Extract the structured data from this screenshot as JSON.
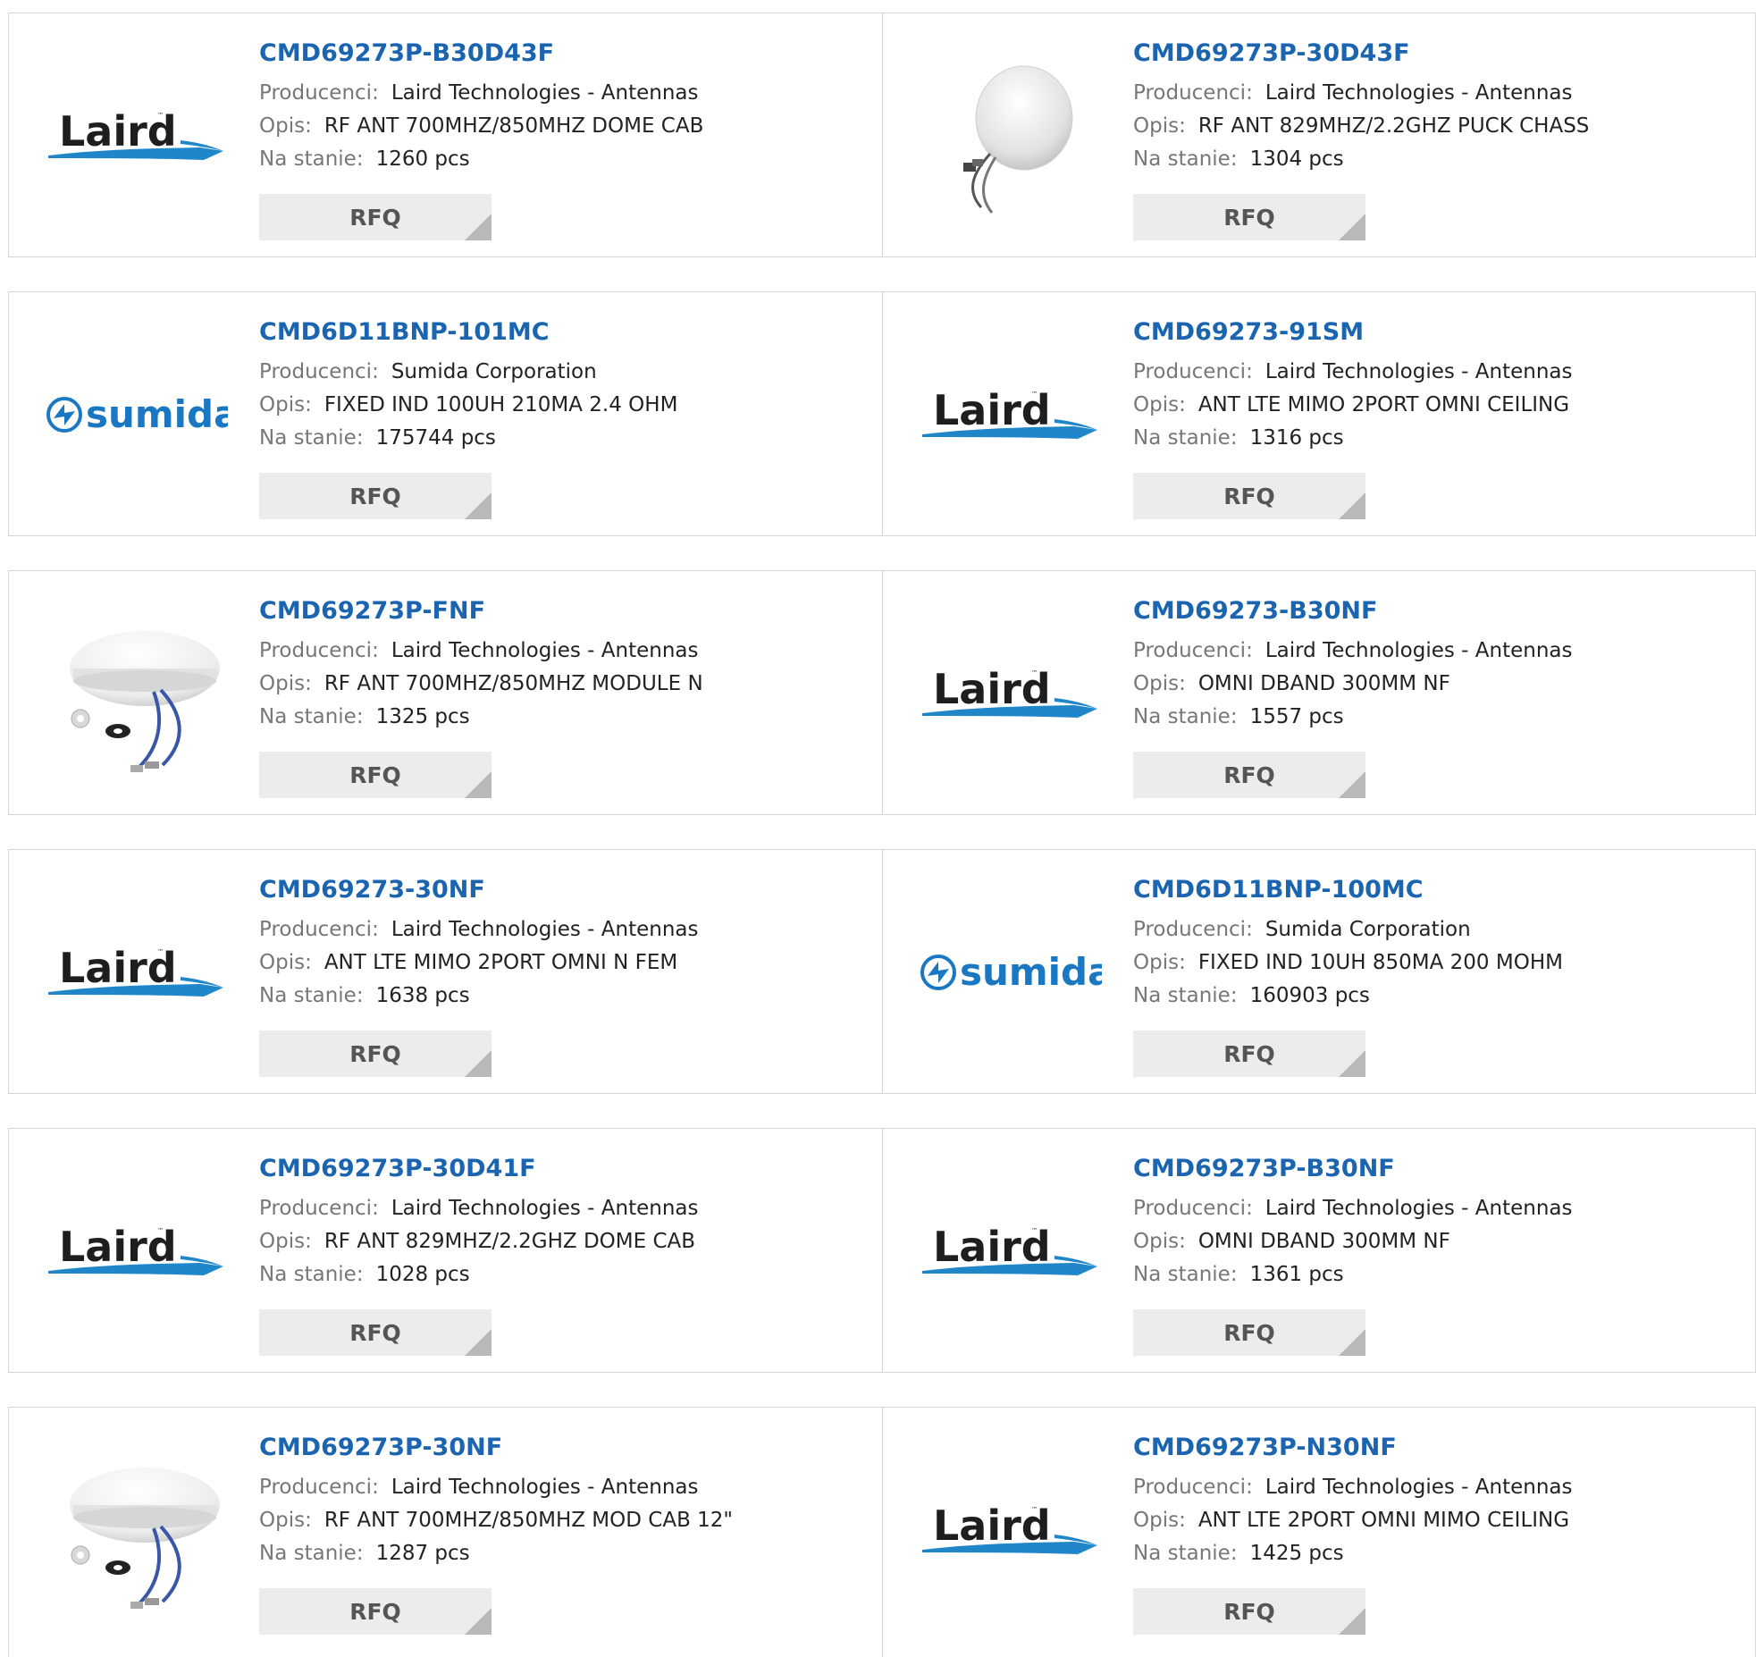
{
  "labels": {
    "manufacturer": "Producenci:",
    "description": "Opis:",
    "stock": "Na stanie:",
    "rfq": "RFQ"
  },
  "products": [
    {
      "part": "CMD69273P-B30D43F",
      "manufacturer": "Laird Technologies - Antennas",
      "description": "RF ANT 700MHZ/850MHZ DOME CAB",
      "stock": "1260 pcs",
      "image": "laird-logo"
    },
    {
      "part": "CMD69273P-30D43F",
      "manufacturer": "Laird Technologies - Antennas",
      "description": "RF ANT 829MHZ/2.2GHZ PUCK CHASS",
      "stock": "1304 pcs",
      "image": "puck-antenna-photo"
    },
    {
      "part": "CMD6D11BNP-101MC",
      "manufacturer": "Sumida Corporation",
      "description": "FIXED IND 100UH 210MA 2.4 OHM",
      "stock": "175744 pcs",
      "image": "sumida-logo"
    },
    {
      "part": "CMD69273-91SM",
      "manufacturer": "Laird Technologies - Antennas",
      "description": "ANT LTE MIMO 2PORT OMNI CEILING",
      "stock": "1316 pcs",
      "image": "laird-logo"
    },
    {
      "part": "CMD69273P-FNF",
      "manufacturer": "Laird Technologies - Antennas",
      "description": "RF ANT 700MHZ/850MHZ MODULE N",
      "stock": "1325 pcs",
      "image": "dome-antenna-photo"
    },
    {
      "part": "CMD69273-B30NF",
      "manufacturer": "Laird Technologies - Antennas",
      "description": "OMNI DBAND 300MM NF",
      "stock": "1557 pcs",
      "image": "laird-logo"
    },
    {
      "part": "CMD69273-30NF",
      "manufacturer": "Laird Technologies - Antennas",
      "description": "ANT LTE MIMO 2PORT OMNI N FEM",
      "stock": "1638 pcs",
      "image": "laird-logo"
    },
    {
      "part": "CMD6D11BNP-100MC",
      "manufacturer": "Sumida Corporation",
      "description": "FIXED IND 10UH 850MA 200 MOHM",
      "stock": "160903 pcs",
      "image": "sumida-logo"
    },
    {
      "part": "CMD69273P-30D41F",
      "manufacturer": "Laird Technologies - Antennas",
      "description": "RF ANT 829MHZ/2.2GHZ DOME CAB",
      "stock": "1028 pcs",
      "image": "laird-logo"
    },
    {
      "part": "CMD69273P-B30NF",
      "manufacturer": "Laird Technologies - Antennas",
      "description": "OMNI DBAND 300MM NF",
      "stock": "1361 pcs",
      "image": "laird-logo"
    },
    {
      "part": "CMD69273P-30NF",
      "manufacturer": "Laird Technologies - Antennas",
      "description": "RF ANT 700MHZ/850MHZ MOD CAB 12\"",
      "stock": "1287 pcs",
      "image": "dome-antenna-photo"
    },
    {
      "part": "CMD69273P-N30NF",
      "manufacturer": "Laird Technologies - Antennas",
      "description": "ANT LTE 2PORT OMNI MIMO CEILING",
      "stock": "1425 pcs",
      "image": "laird-logo"
    }
  ],
  "logo_text": {
    "laird": "Laird",
    "sumida": "sumida"
  },
  "colors": {
    "part_link": "#1b64b0",
    "laird_text": "#1e1e1e",
    "laird_swoosh": "#1f87c9",
    "sumida_blue": "#1a78c2",
    "rfq_bg": "#ececec"
  }
}
